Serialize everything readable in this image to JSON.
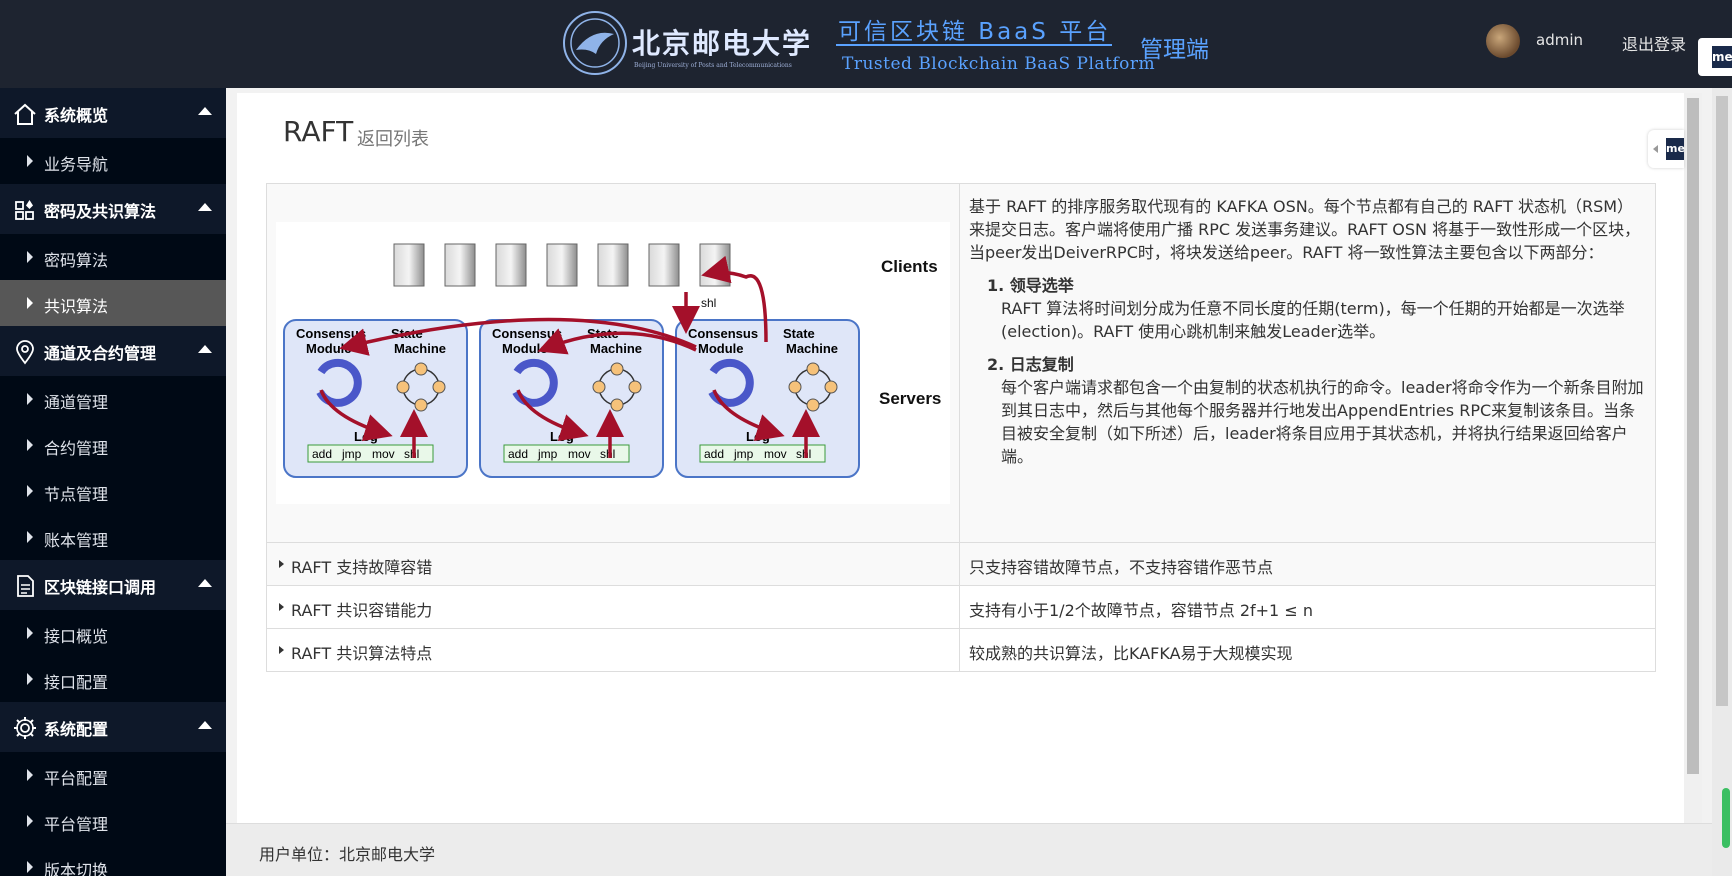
{
  "header": {
    "university_cn": "北京邮电大学",
    "university_en": "Beijing University of Posts and Telecommunications",
    "platform_cn": "可信区块链 BaaS 平台",
    "platform_en": "Trusted Blockchain BaaS Platform",
    "role": "管理端",
    "user": "admin",
    "logout": "退出登录",
    "side_tab": "me"
  },
  "sidebar": {
    "groups": [
      {
        "label": "系统概览",
        "icon": "home-icon",
        "items": [
          {
            "label": "业务导航"
          }
        ]
      },
      {
        "label": "密码及共识算法",
        "icon": "widgets-icon",
        "items": [
          {
            "label": "密码算法"
          },
          {
            "label": "共识算法",
            "active": true
          }
        ]
      },
      {
        "label": "通道及合约管理",
        "icon": "location-icon",
        "items": [
          {
            "label": "通道管理"
          },
          {
            "label": "合约管理"
          },
          {
            "label": "节点管理"
          },
          {
            "label": "账本管理"
          }
        ]
      },
      {
        "label": "区块链接口调用",
        "icon": "document-icon",
        "items": [
          {
            "label": "接口概览"
          },
          {
            "label": "接口配置"
          }
        ]
      },
      {
        "label": "系统配置",
        "icon": "gear-icon",
        "items": [
          {
            "label": "平台配置"
          },
          {
            "label": "平台管理"
          },
          {
            "label": "版本切换"
          }
        ]
      }
    ]
  },
  "main": {
    "title": "RAFT",
    "back_link": "返回列表",
    "diagram": {
      "clients_label": "Clients",
      "servers_label": "Servers",
      "shl_label": "shl",
      "module_label_1": "Consensus",
      "module_label_2": "Module",
      "state_label_1": "State",
      "state_label_2": "Machine",
      "log_label": "Log",
      "log_cells": [
        "add",
        "jmp",
        "mov",
        "shl"
      ]
    },
    "description": {
      "intro": "基于 RAFT 的排序服务取代现有的 KAFKA OSN。每个节点都有自己的 RAFT 状态机（RSM）来提交日志。客户端将使用广播 RPC 发送事务建议。RAFT OSN 将基于一致性形成一个区块，当peer发出DeiverRPC时，将块发送给peer。RAFT 将一致性算法主要包含以下两部分：",
      "h1": "1. 领导选举",
      "p1": "RAFT 算法将时间划分成为任意不同长度的任期(term)，每一个任期的开始都是一次选举(election)。RAFT 使用心跳机制来触发Leader选举。",
      "h2": "2. 日志复制",
      "p2": "每个客户端请求都包含一个由复制的状态机执行的命令。leader将命令作为一个新条目附加到其日志中，然后与其他每个服务器并行地发出AppendEntries RPC来复制该条目。当条目被安全复制（如下所述）后，leader将条目应用于其状态机，并将执行结果返回给客户端。"
    },
    "rows": [
      {
        "label": "RAFT 支持故障容错",
        "value": "只支持容错故障节点，不支持容错作恶节点"
      },
      {
        "label": "RAFT 共识容错能力",
        "value": "支持有小于1/2个故障节点，容错节点 2f+1 ≤ n"
      },
      {
        "label": "RAFT 共识算法特点",
        "value": "较成熟的共识算法，比KAFKA易于大规模实现"
      }
    ]
  },
  "footer": {
    "unit": "用户单位：北京邮电大学"
  }
}
